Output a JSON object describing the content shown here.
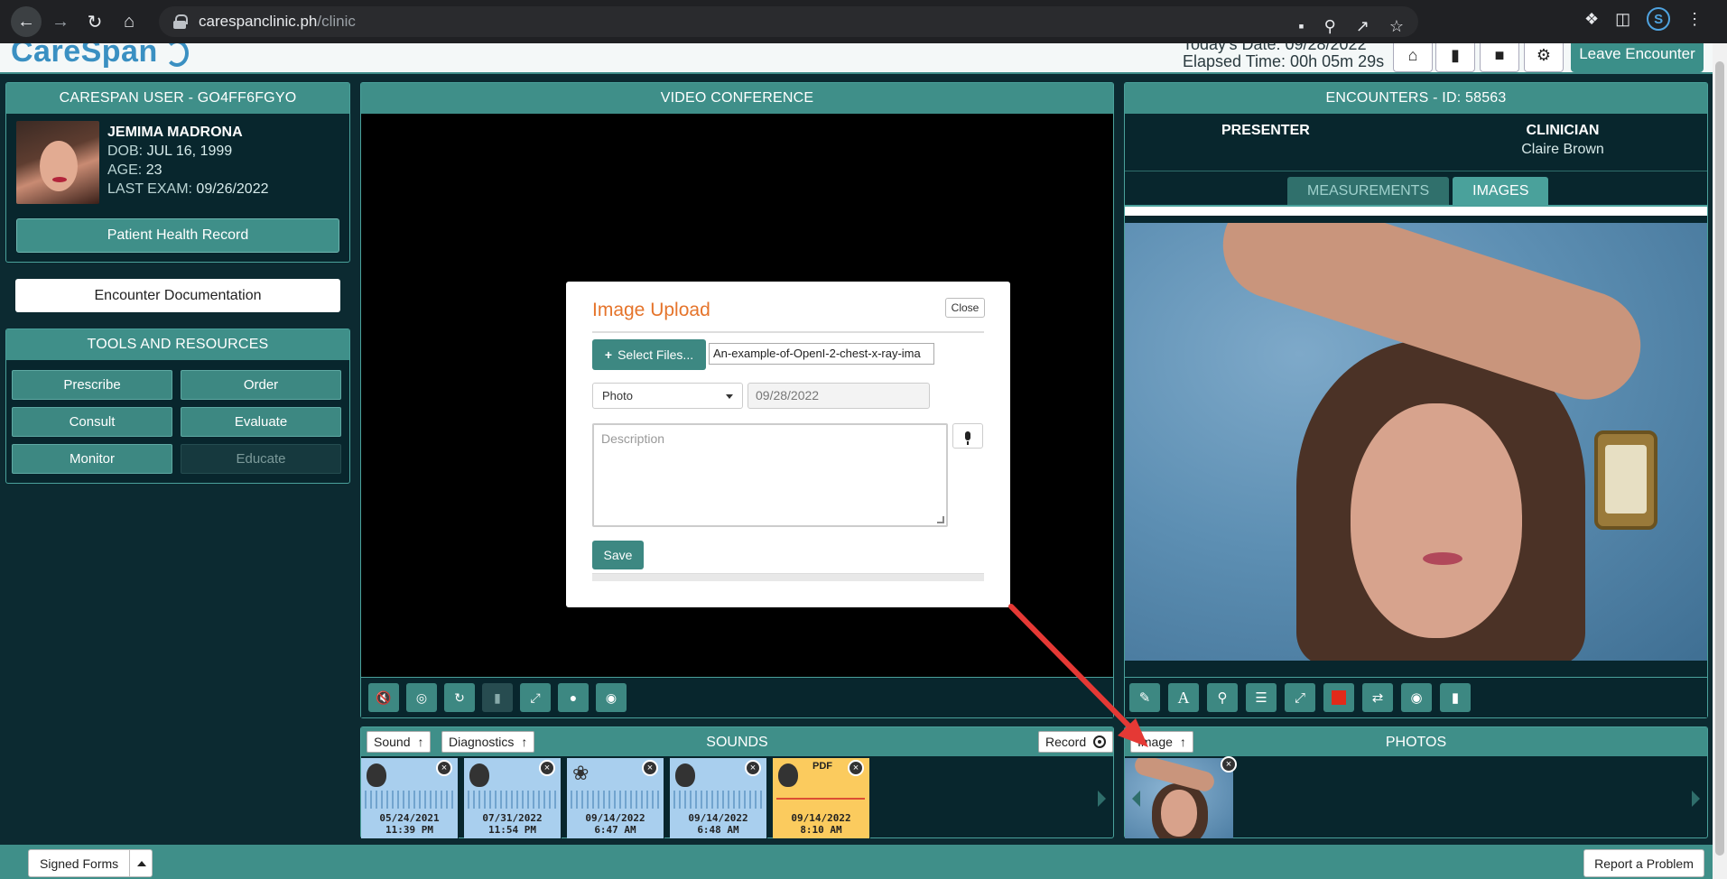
{
  "browser": {
    "url_host": "carespanclinic.ph",
    "url_path": "/clinic"
  },
  "header": {
    "logo": "CareSpan",
    "todays_date": "Today's Date: 09/28/2022",
    "elapsed_time": "Elapsed Time: 00h 05m 29s",
    "leave_label": "Leave Encounter"
  },
  "patient": {
    "panel_title": "CARESPAN USER - GO4FF6FGYO",
    "name": "JEMIMA MADRONA",
    "dob_label": "DOB:",
    "dob": "JUL 16, 1999",
    "age_label": "AGE:",
    "age": "23",
    "last_exam_label": "LAST EXAM:",
    "last_exam": "09/26/2022",
    "phr_label": "Patient Health Record"
  },
  "encounter_doc_label": "Encounter Documentation",
  "tools": {
    "title": "TOOLS AND RESOURCES",
    "items": [
      "Prescribe",
      "Order",
      "Consult",
      "Evaluate",
      "Monitor",
      "Educate"
    ]
  },
  "video": {
    "title": "VIDEO CONFERENCE"
  },
  "modal": {
    "title": "Image Upload",
    "close_label": "Close",
    "select_label": "Select Files...",
    "file_name": "An-example-of-OpenI-2-chest-x-ray-ima",
    "type_value": "Photo",
    "date_value": "09/28/2022",
    "description_placeholder": "Description",
    "save_label": "Save"
  },
  "encounters": {
    "title": "ENCOUNTERS - ID: 58563",
    "presenter_label": "PRESENTER",
    "clinician_label": "CLINICIAN",
    "clinician_name": "Claire Brown",
    "tabs": [
      "MEASUREMENTS",
      "IMAGES"
    ],
    "active_tab": "IMAGES"
  },
  "sounds": {
    "title": "SOUNDS",
    "sound_chip": "Sound",
    "diagnostics_chip": "Diagnostics",
    "record_chip": "Record",
    "tiles": [
      {
        "date": "05/24/2021",
        "time": "11:39 PM",
        "kind": "heart-icon"
      },
      {
        "date": "07/31/2022",
        "time": "11:54 PM",
        "kind": "heart-icon"
      },
      {
        "date": "09/14/2022",
        "time": "6:47 AM",
        "kind": "ear-icon"
      },
      {
        "date": "09/14/2022",
        "time": "6:48 AM",
        "kind": "heart-icon"
      },
      {
        "date": "09/14/2022",
        "time": "8:10 AM",
        "kind": "pdf",
        "pdf_label": "PDF"
      }
    ]
  },
  "photos": {
    "title": "PHOTOS",
    "image_chip": "Image"
  },
  "footer": {
    "signed_forms": "Signed Forms",
    "report": "Report a Problem"
  },
  "colors": {
    "teal": "#3f8f89",
    "dark_bg": "#08262d",
    "accent_orange": "#e5742b",
    "arrow_red": "#e53935"
  }
}
